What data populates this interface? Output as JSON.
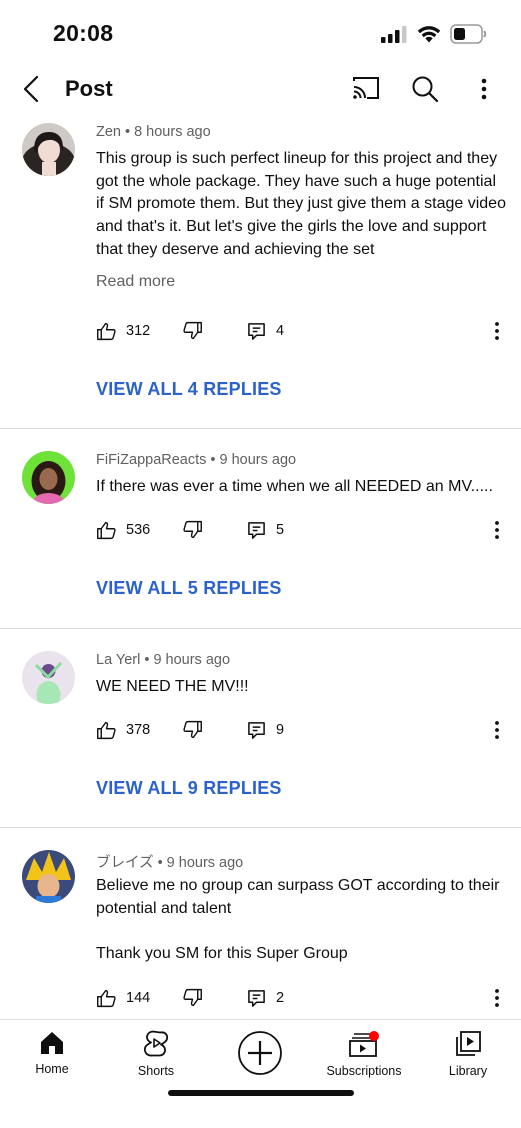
{
  "status_bar": {
    "time": "20:08"
  },
  "header": {
    "title": "Post"
  },
  "comments": [
    {
      "author": "Zen",
      "time": "8 hours ago",
      "text": "This group is such perfect lineup for this project and they got the whole package. They have such a huge potential if SM promote them. But they just give them a stage video and that's it. But let's give the girls the love and support that they deserve and achieving the set",
      "read_more": "Read more",
      "likes": "312",
      "replies": "4",
      "view_replies": "VIEW ALL 4 REPLIES"
    },
    {
      "author": "FiFiZappaReacts",
      "time": "9 hours ago",
      "text": "If there was ever a time when we all NEEDED an MV.....",
      "likes": "536",
      "replies": "5",
      "view_replies": "VIEW ALL 5 REPLIES"
    },
    {
      "author": "La Yerl",
      "time": "9 hours ago",
      "text": "WE NEED THE MV!!!",
      "likes": "378",
      "replies": "9",
      "view_replies": "VIEW ALL 9 REPLIES"
    },
    {
      "author": "ブレイズ",
      "time": "9 hours ago",
      "text": "Believe me no group can surpass GOT according to their potential and talent",
      "text_2": "Thank you SM for this Super Group",
      "likes": "144",
      "replies": "2"
    }
  ],
  "bottom_nav": {
    "items": [
      {
        "label": "Home",
        "icon": "home-icon"
      },
      {
        "label": "Shorts",
        "icon": "shorts-icon"
      },
      {
        "label": "",
        "icon": "create-plus-icon"
      },
      {
        "label": "Subscriptions",
        "icon": "subscriptions-icon"
      },
      {
        "label": "Library",
        "icon": "library-icon"
      }
    ]
  },
  "colors": {
    "link": "#2c62c9",
    "notification_dot": "#ff0000",
    "secondary_text": "#606060"
  }
}
